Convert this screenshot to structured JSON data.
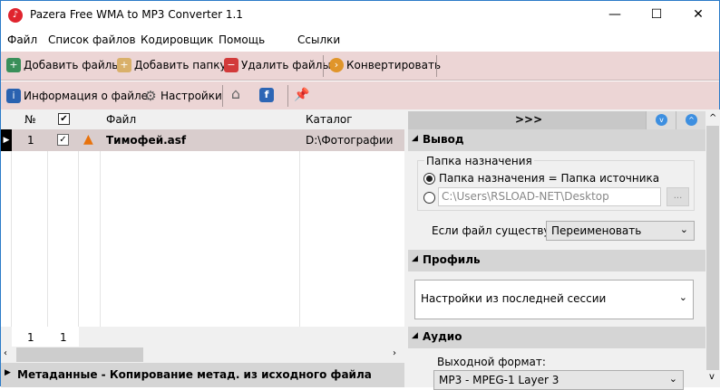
{
  "window": {
    "title": "Pazera Free WMA to MP3 Converter 1.1",
    "minimize": "—",
    "maximize": "☐",
    "close": "✕"
  },
  "menu": [
    "Файл",
    "Список файлов",
    "Кодировщик",
    "Помощь",
    "Ссылки"
  ],
  "toolbar1": {
    "add_files": "Добавить файлы",
    "add_folder": "Добавить папку",
    "remove_files": "Удалить файлы",
    "convert": "Конвертировать"
  },
  "toolbar2": {
    "file_info": "Информация о файле",
    "settings": "Настройки"
  },
  "grid": {
    "headers": {
      "num": "№",
      "file": "Файл",
      "folder": "Каталог"
    },
    "rows": [
      {
        "num": "1",
        "checked": true,
        "file": "Тимофей.asf",
        "folder": "D:\\Фотографии"
      }
    ],
    "footer": {
      "count": "1",
      "checked_count": "1"
    }
  },
  "metadata_bar": "Метаданные - Копирование метад. из исходного файла",
  "right_panel": {
    "expand": ">>>",
    "output": {
      "title": "Вывод",
      "group": "Папка назначения",
      "opt_source": "Папка назначения = Папка источника",
      "path": "C:\\Users\\RSLOAD-NET\\Desktop",
      "browse": "...",
      "exists_label": "Если  файл  существует:",
      "exists_value": "Переименовать"
    },
    "profile": {
      "title": "Профиль",
      "value": "Настройки из последней сессии"
    },
    "audio": {
      "title": "Аудио",
      "format_label": "Выходной формат:",
      "format_value": "MP3 - MPEG-1 Layer 3"
    }
  }
}
